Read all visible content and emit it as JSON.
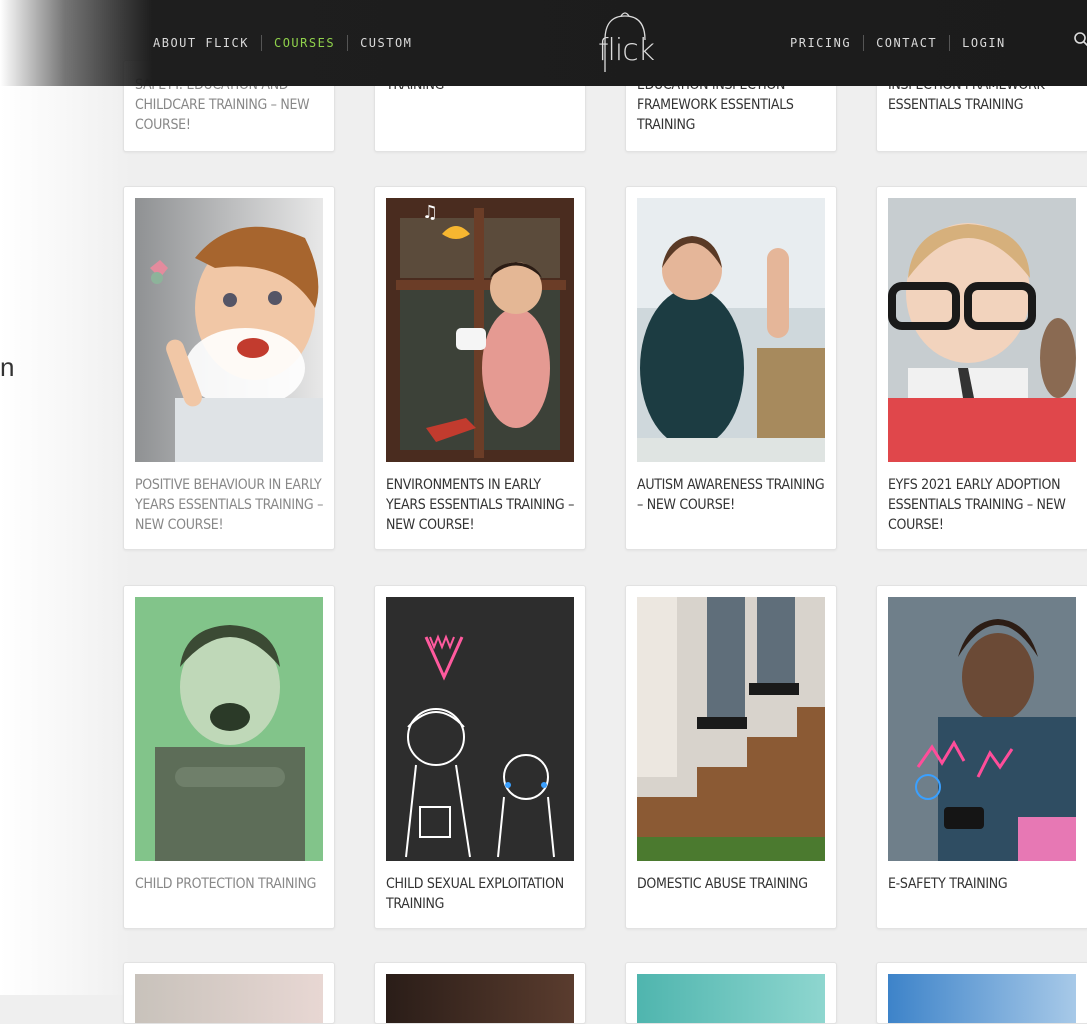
{
  "nav": {
    "left": [
      "ABOUT FLICK",
      "COURSES",
      "CUSTOM"
    ],
    "right": [
      "PRICING",
      "CONTACT",
      "LOGIN"
    ],
    "active": "COURSES",
    "logo_text": "flick"
  },
  "stray_letter": "n",
  "colors": {
    "nav_bg": "#1b1b1b",
    "active": "#8fd14b"
  },
  "courses_top": [
    {
      "title": "SAFETY: EDUCATION AND CHILDCARE TRAINING – NEW COURSE!"
    },
    {
      "title": "TRAINING"
    },
    {
      "title": "EDUCATION INSPECTION FRAMEWORK ESSENTIALS TRAINING"
    },
    {
      "title": "INSPECTION FRAMEWORK ESSENTIALS TRAINING"
    }
  ],
  "courses": [
    {
      "title": "POSITIVE BEHAVIOUR IN EARLY YEARS ESSENTIALS TRAINING – NEW COURSE!"
    },
    {
      "title": "ENVIRONMENTS IN EARLY YEARS ESSENTIALS TRAINING – NEW COURSE!"
    },
    {
      "title": "AUTISM AWARENESS TRAINING – NEW COURSE!"
    },
    {
      "title": "EYFS 2021 EARLY ADOPTION ESSENTIALS TRAINING – NEW COURSE!"
    },
    {
      "title": "CHILD PROTECTION TRAINING"
    },
    {
      "title": "CHILD SEXUAL EXPLOITATION TRAINING"
    },
    {
      "title": "DOMESTIC ABUSE TRAINING"
    },
    {
      "title": "E-SAFETY TRAINING"
    }
  ]
}
